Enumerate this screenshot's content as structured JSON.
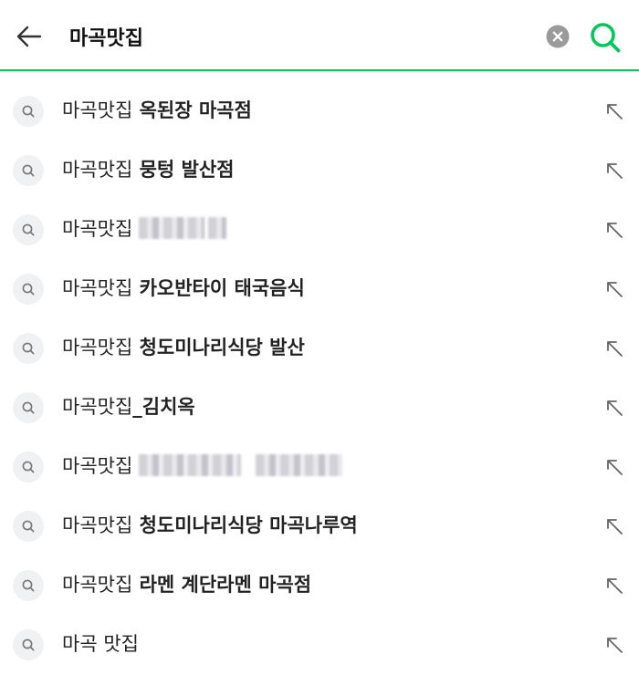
{
  "search": {
    "query": "마곡맛집",
    "back_icon": "arrow-left-icon",
    "clear_icon": "close-circle-icon",
    "submit_icon": "search-icon"
  },
  "colors": {
    "accent": "#03c75a",
    "text": "#222222",
    "icon_bg": "#f0f1f3",
    "clear_bg": "#9a9a9a"
  },
  "suggestions": [
    {
      "prefix": "마곡맛집",
      "rest": " 옥된장 마곡점"
    },
    {
      "prefix": "마곡맛집",
      "rest": " 뭉텅 발산점"
    },
    {
      "prefix": "마곡맛집",
      "rest": ""
    },
    {
      "prefix": "마곡맛집",
      "rest": " 카오반타이 태국음식"
    },
    {
      "prefix": "마곡맛집",
      "rest": " 청도미나리식당 발산"
    },
    {
      "prefix": "마곡맛집",
      "rest": "_김치옥"
    },
    {
      "prefix": "마곡맛집",
      "rest": ""
    },
    {
      "prefix": "마곡맛집",
      "rest": " 청도미나리식당 마곡나루역"
    },
    {
      "prefix": "마곡맛집",
      "rest": " 라멘 계단라멘 마곡점"
    },
    {
      "prefix": "마곡 맛집",
      "rest": ""
    }
  ]
}
